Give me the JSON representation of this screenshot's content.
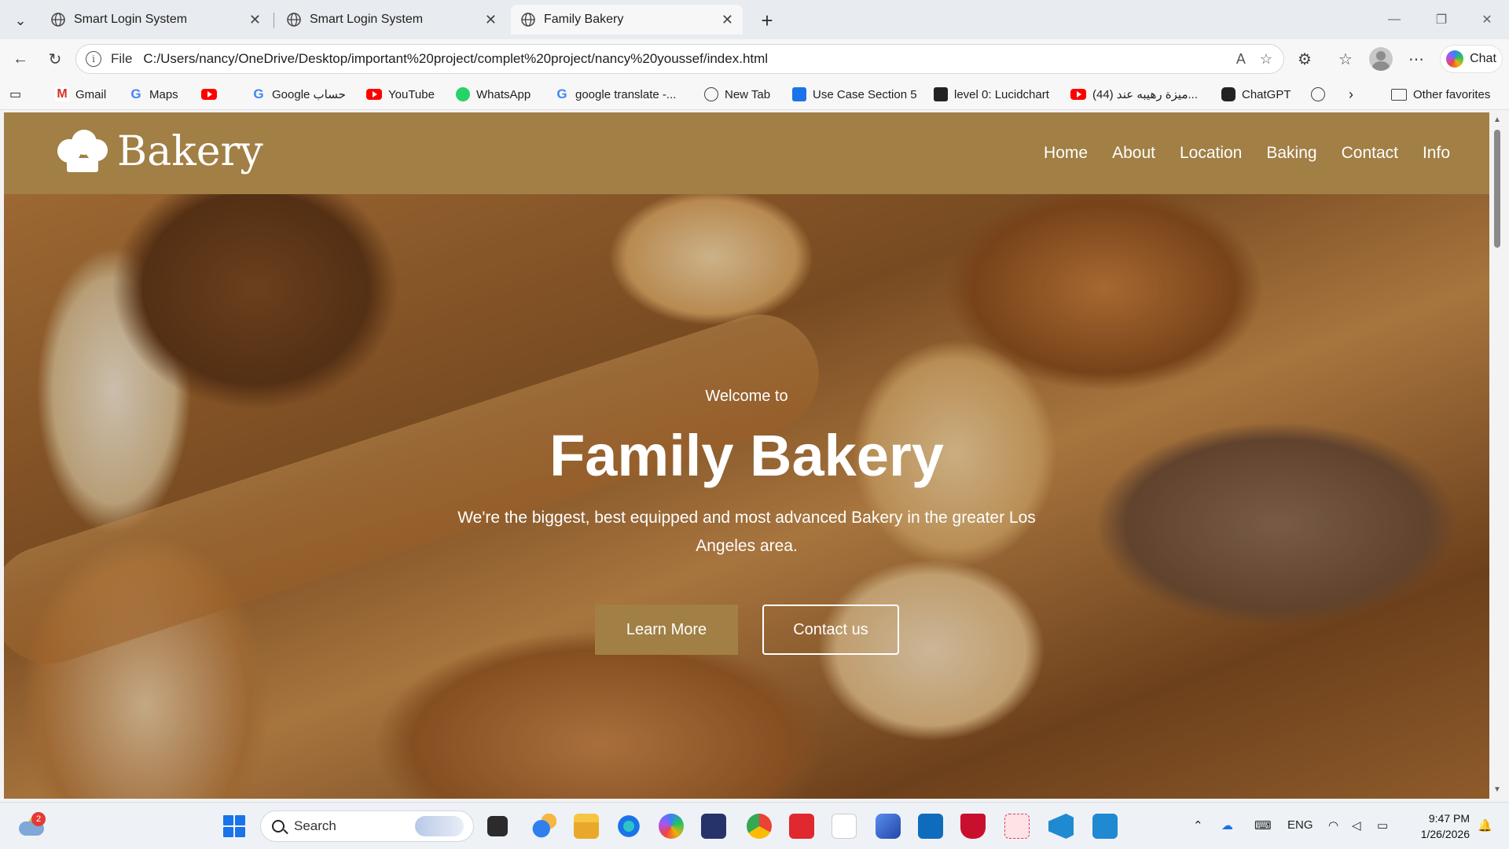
{
  "browser": {
    "tabs": [
      {
        "title": "Smart Login System",
        "active": false
      },
      {
        "title": "Smart Login System",
        "active": false
      },
      {
        "title": "Family Bakery",
        "active": true
      }
    ],
    "address": {
      "file_label": "File",
      "url": "C:/Users/nancy/OneDrive/Desktop/important%20project/complet%20project/nancy%20youssef/index.html"
    },
    "chat_label": "Chat",
    "favorites": [
      {
        "label": "Gmail",
        "icon": "gmail-icon"
      },
      {
        "label": "Maps",
        "icon": "google-icon"
      },
      {
        "label": "",
        "icon": "youtube-icon"
      },
      {
        "label": "Google حساب",
        "icon": "google-icon"
      },
      {
        "label": "YouTube",
        "icon": "youtube-icon"
      },
      {
        "label": "WhatsApp",
        "icon": "whatsapp-icon"
      },
      {
        "label": "google translate -...",
        "icon": "google-icon"
      },
      {
        "label": "New Tab",
        "icon": "globe-icon"
      },
      {
        "label": "Use Case Section 5",
        "icon": "bookmark-icon"
      },
      {
        "label": "level 0: Lucidchart",
        "icon": "lucidchart-icon"
      },
      {
        "label": "(44) ميزة رهيبه عند...",
        "icon": "youtube-icon"
      },
      {
        "label": "ChatGPT",
        "icon": "chatgpt-icon"
      },
      {
        "label": "",
        "icon": "globe-icon"
      }
    ],
    "other_favorites": "Other favorites"
  },
  "site": {
    "brand": "Bakery",
    "nav": [
      "Home",
      "About",
      "Location",
      "Baking",
      "Contact",
      "Info"
    ],
    "hero": {
      "welcome": "Welcome to",
      "title": "Family Bakery",
      "description": "We're the biggest, best equipped and most advanced Bakery in the greater Los Angeles area.",
      "primary_button": "Learn More",
      "secondary_button": "Contact us"
    },
    "colors": {
      "brand": "#a17f45",
      "text": "#ffffff"
    }
  },
  "taskbar": {
    "weather_badge": "2",
    "search_placeholder": "Search",
    "language": "ENG",
    "time": "9:47 PM",
    "date": "1/26/2026"
  }
}
